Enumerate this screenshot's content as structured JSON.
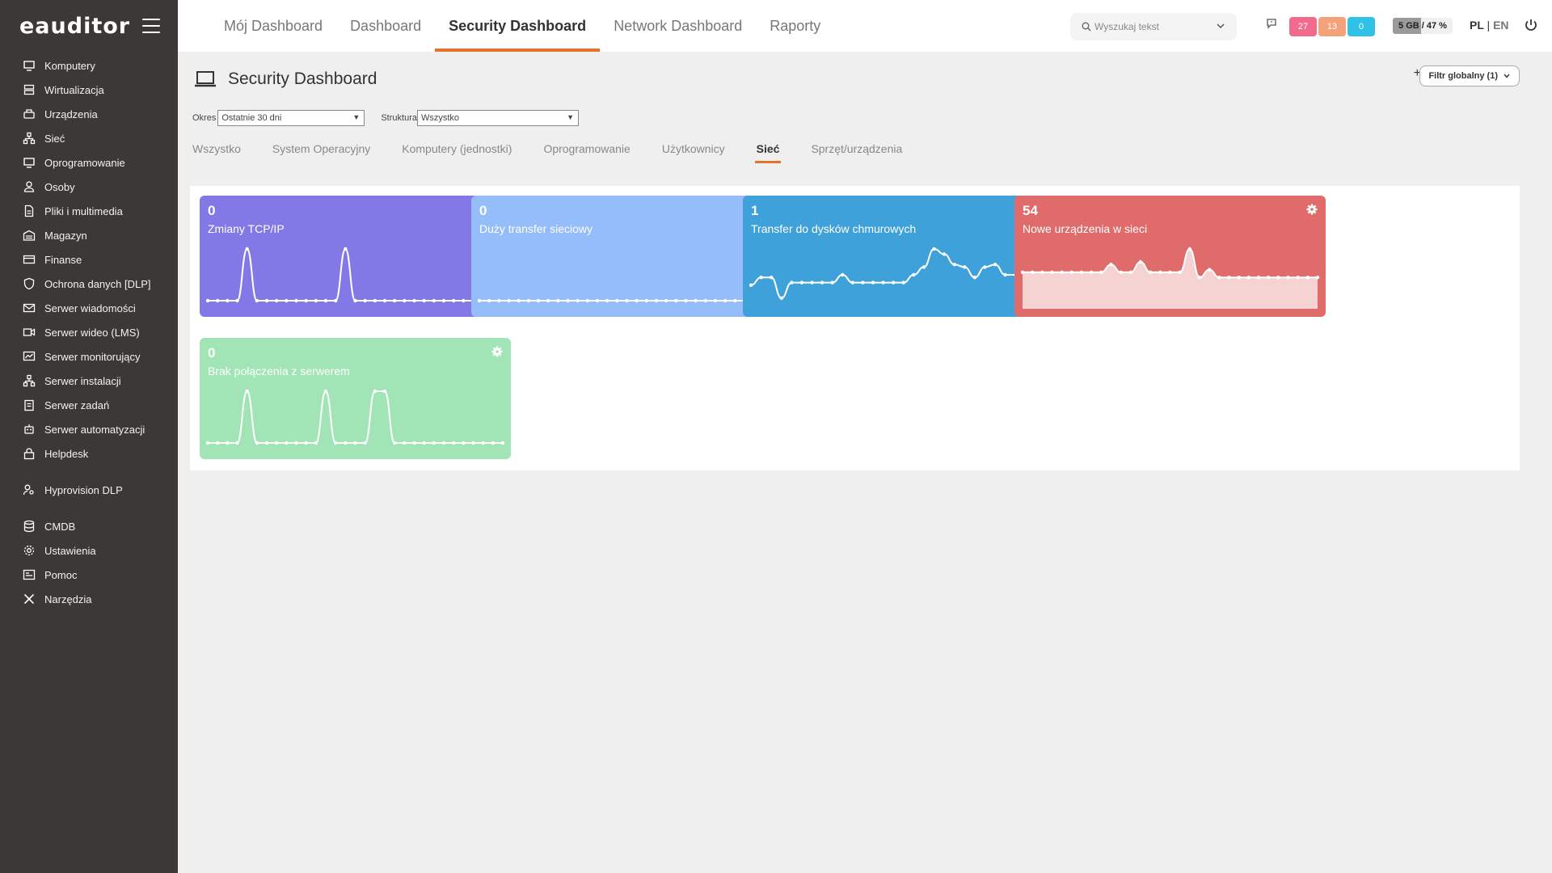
{
  "app": {
    "logo": "eauditor"
  },
  "sidebar": {
    "items": [
      {
        "label": "Komputery",
        "icon": "monitor-icon"
      },
      {
        "label": "Wirtualizacja",
        "icon": "server-icon"
      },
      {
        "label": "Urządzenia",
        "icon": "devices-icon"
      },
      {
        "label": "Sieć",
        "icon": "network-icon"
      },
      {
        "label": "Oprogramowanie",
        "icon": "monitor-icon"
      },
      {
        "label": "Osoby",
        "icon": "users-icon"
      },
      {
        "label": "Pliki i multimedia",
        "icon": "file-icon"
      },
      {
        "label": "Magazyn",
        "icon": "warehouse-icon"
      },
      {
        "label": "Finanse",
        "icon": "wallet-icon"
      },
      {
        "label": "Ochrona danych [DLP]",
        "icon": "shield-icon"
      },
      {
        "label": "Serwer wiadomości",
        "icon": "mail-icon"
      },
      {
        "label": "Serwer wideo (LMS)",
        "icon": "video-icon"
      },
      {
        "label": "Serwer monitorujący",
        "icon": "chart-icon"
      },
      {
        "label": "Serwer instalacji",
        "icon": "network-icon"
      },
      {
        "label": "Serwer zadań",
        "icon": "clipboard-icon"
      },
      {
        "label": "Serwer automatyzacji",
        "icon": "robot-icon"
      },
      {
        "label": "Helpdesk",
        "icon": "lock-icon"
      }
    ],
    "group2": [
      {
        "label": "Hyprovision DLP",
        "icon": "user-key-icon"
      }
    ],
    "group3": [
      {
        "label": "CMDB",
        "icon": "database-icon"
      },
      {
        "label": "Ustawienia",
        "icon": "gear-icon"
      },
      {
        "label": "Pomoc",
        "icon": "help-icon"
      },
      {
        "label": "Narzędzia",
        "icon": "tools-icon"
      }
    ]
  },
  "topbar": {
    "tabs": [
      {
        "label": "Mój Dashboard"
      },
      {
        "label": "Dashboard"
      },
      {
        "label": "Security Dashboard"
      },
      {
        "label": "Network Dashboard"
      },
      {
        "label": "Raporty"
      }
    ],
    "active_tab": "Security Dashboard",
    "search_placeholder": "Wyszukaj tekst",
    "badges": [
      {
        "value": "27",
        "color": "#f26b8f"
      },
      {
        "value": "13",
        "color": "#f5a27a"
      },
      {
        "value": "0",
        "color": "#2fc1e6"
      }
    ],
    "disk_label": "5 GB / 47 %",
    "disk_percent": 47,
    "lang_pl": "PL",
    "lang_sep": "|",
    "lang_en": "EN"
  },
  "page": {
    "title": "Security Dashboard",
    "filter_button": "Filtr globalny (1)",
    "period_label": "Okres",
    "period_value": "Ostatnie 30 dni",
    "structure_label": "Struktura",
    "structure_value": "Wszystko",
    "subtabs": [
      {
        "label": "Wszystko"
      },
      {
        "label": "System Operacyjny"
      },
      {
        "label": "Komputery (jednostki)"
      },
      {
        "label": "Oprogramowanie"
      },
      {
        "label": "Użytkownicy"
      },
      {
        "label": "Sieć"
      },
      {
        "label": "Sprzęt/urządzenia"
      }
    ],
    "active_subtab": "Sieć"
  },
  "cards": [
    {
      "value": "0",
      "label": "Zmiany TCP/IP",
      "color": "#8379e6",
      "series": [
        0,
        0,
        0,
        0,
        1,
        0,
        0,
        0,
        0,
        0,
        0,
        0,
        0,
        0,
        1,
        0,
        0,
        0,
        0,
        0,
        0,
        0,
        0,
        0,
        0,
        0,
        0,
        0,
        0,
        0,
        0
      ],
      "fill": false
    },
    {
      "value": "0",
      "label": "Duży transfer sieciowy",
      "color": "#94bdf9",
      "series": [
        0,
        0,
        0,
        0,
        0,
        0,
        0,
        0,
        0,
        0,
        0,
        0,
        0,
        0,
        0,
        0,
        0,
        0,
        0,
        0,
        0,
        0,
        0,
        0,
        0,
        0,
        0,
        0,
        0,
        0,
        0
      ],
      "fill": false
    },
    {
      "value": "1",
      "label": "Transfer do dysków chmurowych",
      "color": "#3ea1da",
      "series": [
        0.3,
        0.45,
        0.45,
        0.05,
        0.35,
        0.35,
        0.35,
        0.35,
        0.35,
        0.5,
        0.35,
        0.35,
        0.35,
        0.35,
        0.35,
        0.35,
        0.5,
        0.65,
        1.0,
        0.9,
        0.7,
        0.65,
        0.45,
        0.65,
        0.7,
        0.5,
        0.5,
        0.5,
        0.35,
        0.35
      ],
      "fill": false
    },
    {
      "value": "54",
      "label": "Nowe urządzenia w sieci",
      "color": "#df6b6b",
      "series": [
        0.55,
        0.55,
        0.55,
        0.55,
        0.55,
        0.55,
        0.55,
        0.55,
        0.55,
        0.7,
        0.55,
        0.55,
        0.75,
        0.55,
        0.55,
        0.55,
        0.55,
        1.0,
        0.45,
        0.6,
        0.45,
        0.45,
        0.45,
        0.45,
        0.45,
        0.45,
        0.45,
        0.45,
        0.45,
        0.45,
        0.45
      ],
      "fill": true
    },
    {
      "value": "0",
      "label": "Brak połączenia z serwerem",
      "color": "#a1e5b7",
      "series": [
        0,
        0,
        0,
        0,
        1,
        0,
        0,
        0,
        0,
        0,
        0,
        0,
        1,
        0,
        0,
        0,
        0,
        1,
        1,
        0,
        0,
        0,
        0,
        0,
        0,
        0,
        0,
        0,
        0,
        0,
        0
      ],
      "fill": false
    }
  ]
}
